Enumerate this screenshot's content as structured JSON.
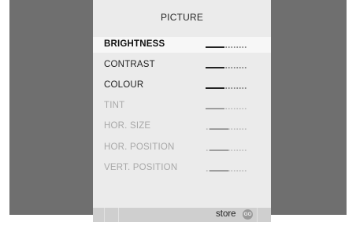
{
  "menu": {
    "title": "PICTURE",
    "items": [
      {
        "label": "BRIGHTNESS",
        "enabled": true,
        "selected": true,
        "level": 0.45
      },
      {
        "label": "CONTRAST",
        "enabled": true,
        "selected": false,
        "level": 0.45
      },
      {
        "label": "COLOUR",
        "enabled": true,
        "selected": false,
        "level": 0.45
      },
      {
        "label": "TINT",
        "enabled": false,
        "selected": false,
        "level": 0.45
      },
      {
        "label": "HOR. SIZE",
        "enabled": false,
        "selected": false,
        "level": 0.55
      },
      {
        "label": "HOR. POSITION",
        "enabled": false,
        "selected": false,
        "level": 0.55
      },
      {
        "label": "VERT. POSITION",
        "enabled": false,
        "selected": false,
        "level": 0.55
      }
    ]
  },
  "footer": {
    "store_label": "store",
    "go_icon": "GO"
  },
  "colors": {
    "side_panel": "#6f6f6f",
    "menu_bg": "#ebebeb",
    "selected_row": "#f7f7f7",
    "bottom_bar": "#cfcfcf"
  }
}
